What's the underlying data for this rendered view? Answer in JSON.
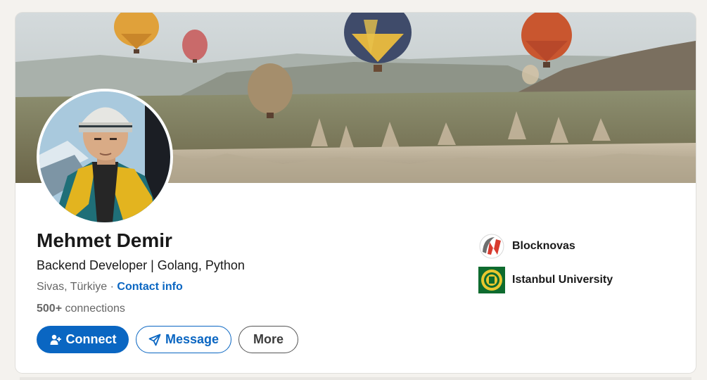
{
  "profile": {
    "name": "Mehmet Demir",
    "headline": "Backend Developer | Golang, Python",
    "location": "Sivas, Türkiye",
    "separator": " · ",
    "contact_info_label": "Contact info",
    "connections_count": "500+",
    "connections_label": " connections"
  },
  "actions": {
    "connect_label": "Connect",
    "message_label": "Message",
    "more_label": "More"
  },
  "organizations": [
    {
      "name": "Blocknovas",
      "logo": "blocknovas-logo"
    },
    {
      "name": "Istanbul University",
      "logo": "istanbul-university-logo"
    }
  ],
  "colors": {
    "accent": "#0a66c2",
    "text_primary": "#191919",
    "text_secondary": "#666666",
    "page_background": "#f4f2ee"
  },
  "icons": {
    "connect": "add-person-icon",
    "message": "paper-plane-icon"
  }
}
